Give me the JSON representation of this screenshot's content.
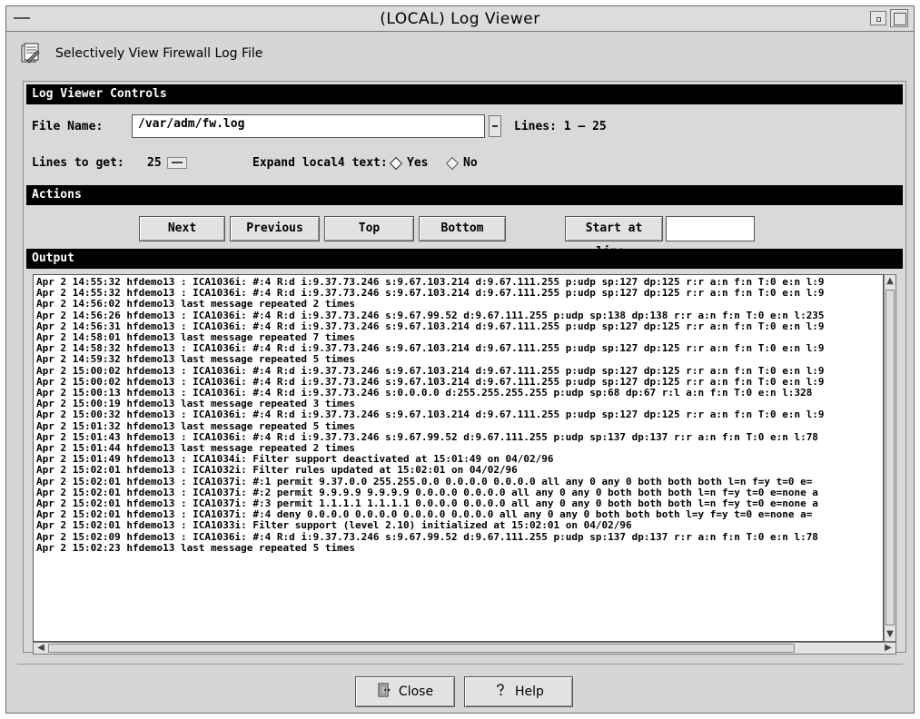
{
  "window": {
    "title": "(LOCAL) Log Viewer"
  },
  "header": {
    "title": "Selectively View Firewall Log File",
    "icon": "log-document-icon"
  },
  "controls": {
    "section_label": "Log Viewer Controls",
    "file_name_label": "File Name:",
    "file_name_value": "/var/adm/fw.log",
    "lines_range": "Lines: 1 – 25",
    "lines_to_get_label": "Lines to get:",
    "lines_to_get_value": "25",
    "expand_label": "Expand local4 text:",
    "expand_yes": "Yes",
    "expand_no": "No",
    "expand_selected": "Yes"
  },
  "actions": {
    "section_label": "Actions",
    "next": "Next",
    "previous": "Previous",
    "top": "Top",
    "bottom": "Bottom",
    "start_at_line_label": "Start at line:",
    "start_at_line_value": ""
  },
  "output": {
    "section_label": "Output",
    "lines": [
      "Apr  2 14:55:32 hfdemo13 : ICA1036i: #:4 R:d  i:9.37.73.246 s:9.67.103.214 d:9.67.111.255 p:udp sp:127 dp:125 r:r a:n f:n T:0 e:n l:9",
      "Apr  2 14:55:32 hfdemo13 : ICA1036i: #:4 R:d  i:9.37.73.246 s:9.67.103.214 d:9.67.111.255 p:udp sp:127 dp:125 r:r a:n f:n T:0 e:n l:9",
      "Apr  2 14:56:02 hfdemo13 last message repeated 2 times",
      "Apr  2 14:56:26 hfdemo13 : ICA1036i: #:4 R:d  i:9.37.73.246 s:9.67.99.52 d:9.67.111.255 p:udp sp:138 dp:138 r:r a:n f:n T:0 e:n l:235",
      "Apr  2 14:56:31 hfdemo13 : ICA1036i: #:4 R:d  i:9.37.73.246 s:9.67.103.214 d:9.67.111.255 p:udp sp:127 dp:125 r:r a:n f:n T:0 e:n l:9",
      "Apr  2 14:58:01 hfdemo13 last message repeated 7 times",
      "Apr  2 14:58:32 hfdemo13 : ICA1036i: #:4 R:d  i:9.37.73.246 s:9.67.103.214 d:9.67.111.255 p:udp sp:127 dp:125 r:r a:n f:n T:0 e:n l:9",
      "Apr  2 14:59:32 hfdemo13 last message repeated 5 times",
      "Apr  2 15:00:02 hfdemo13 : ICA1036i: #:4 R:d  i:9.37.73.246 s:9.67.103.214 d:9.67.111.255 p:udp sp:127 dp:125 r:r a:n f:n T:0 e:n l:9",
      "Apr  2 15:00:02 hfdemo13 : ICA1036i: #:4 R:d  i:9.37.73.246 s:9.67.103.214 d:9.67.111.255 p:udp sp:127 dp:125 r:r a:n f:n T:0 e:n l:9",
      "Apr  2 15:00:13 hfdemo13 : ICA1036i: #:4 R:d  i:9.37.73.246 s:0.0.0.0 d:255.255.255.255 p:udp sp:68 dp:67 r:l a:n f:n T:0 e:n l:328",
      "Apr  2 15:00:19 hfdemo13 last message repeated 3 times",
      "Apr  2 15:00:32 hfdemo13 : ICA1036i: #:4 R:d  i:9.37.73.246 s:9.67.103.214 d:9.67.111.255 p:udp sp:127 dp:125 r:r a:n f:n T:0 e:n l:9",
      "Apr  2 15:01:32 hfdemo13 last message repeated 5 times",
      "Apr  2 15:01:43 hfdemo13 : ICA1036i: #:4 R:d  i:9.37.73.246 s:9.67.99.52 d:9.67.111.255 p:udp sp:137 dp:137 r:r a:n f:n T:0 e:n l:78",
      "Apr  2 15:01:44 hfdemo13 last message repeated 2 times",
      "Apr  2 15:01:49 hfdemo13 : ICA1034i: Filter support deactivated at 15:01:49 on 04/02/96",
      "Apr  2 15:02:01 hfdemo13 : ICA1032i: Filter rules updated at 15:02:01 on 04/02/96",
      "Apr  2 15:02:01 hfdemo13 : ICA1037i: #:1 permit 9.37.0.0 255.255.0.0 0.0.0.0 0.0.0.0 all any 0 any 0 both both both l=n f=y t=0 e=",
      "Apr  2 15:02:01 hfdemo13 : ICA1037i: #:2 permit 9.9.9.9 9.9.9.9 0.0.0.0 0.0.0.0 all any 0 any 0 both both both l=n f=y t=0 e=none a",
      "Apr  2 15:02:01 hfdemo13 : ICA1037i: #:3 permit 1.1.1.1 1.1.1.1 0.0.0.0 0.0.0.0 all any 0 any 0 both both both l=n f=y t=0 e=none a",
      "Apr  2 15:02:01 hfdemo13 : ICA1037i: #:4 deny 0.0.0.0 0.0.0.0 0.0.0.0 0.0.0.0 all any 0 any 0 both both both l=y f=y t=0 e=none a=",
      "Apr  2 15:02:01 hfdemo13 : ICA1033i: Filter support (level 2.10) initialized at 15:02:01 on 04/02/96",
      "Apr  2 15:02:09 hfdemo13 : ICA1036i: #:4 R:d  i:9.37.73.246 s:9.67.99.52 d:9.67.111.255 p:udp sp:137 dp:137 r:r a:n f:n T:0 e:n l:78",
      "Apr  2 15:02:23 hfdemo13 last message repeated 5 times"
    ]
  },
  "footer": {
    "close": "Close",
    "help": "Help",
    "close_icon": "close-door-icon",
    "help_icon": "help-question-icon"
  }
}
